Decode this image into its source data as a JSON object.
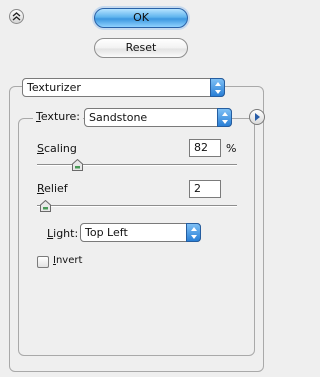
{
  "buttons": {
    "ok_label": "OK",
    "reset_label": "Reset"
  },
  "filter": {
    "selected": "Texturizer"
  },
  "texture": {
    "label_first": "T",
    "label_rest": "exture:",
    "selected": "Sandstone"
  },
  "scaling": {
    "label_first": "S",
    "label_rest": "caling",
    "value": "82",
    "unit": "%",
    "fraction": 0.2
  },
  "relief": {
    "label_first": "R",
    "label_rest": "elief",
    "value": "2",
    "fraction": 0.04
  },
  "light": {
    "label_first": "L",
    "label_rest": "ight:",
    "selected": "Top Left"
  },
  "invert": {
    "label_first": "I",
    "label_rest": "nvert",
    "checked": false
  },
  "colors": {
    "ok_button": "#5fb4ee",
    "stepper": "#2a7fd6",
    "background": "#efefef"
  },
  "icons": {
    "collapse": "double-chevron-up-icon",
    "texture_menu": "triangle-right-icon",
    "thumb": "slider-thumb-icon"
  }
}
